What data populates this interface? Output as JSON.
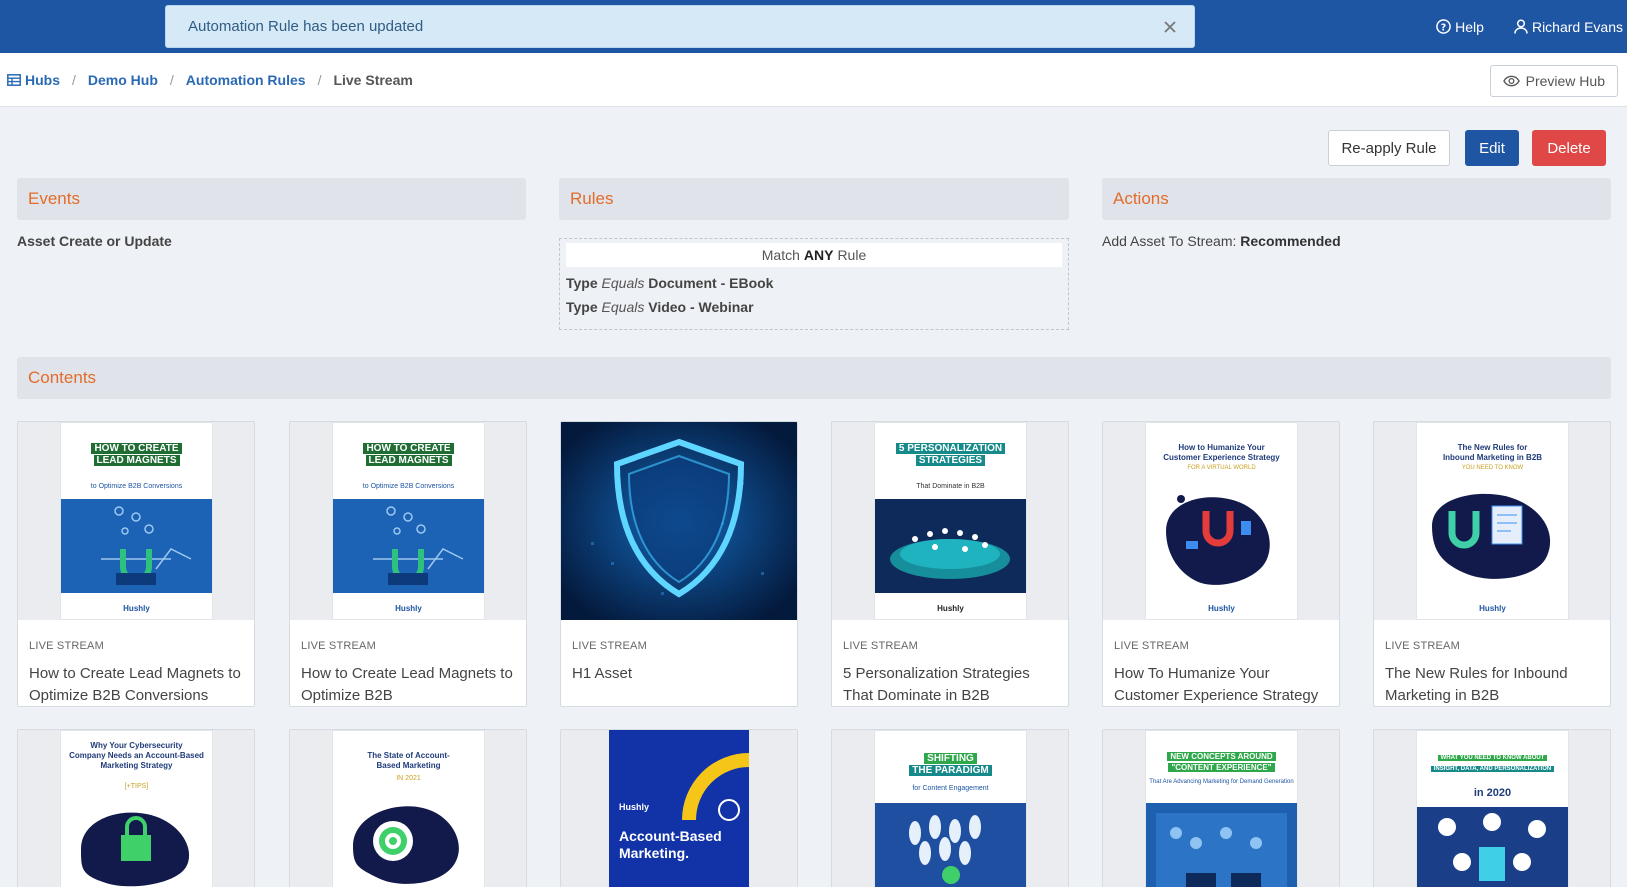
{
  "topbar": {
    "help": "Help",
    "user": "Richard Evans",
    "toast": "Automation Rule has been updated"
  },
  "breadcrumb": {
    "items": [
      "Hubs",
      "Demo Hub",
      "Automation Rules"
    ],
    "current": "Live Stream",
    "preview": "Preview Hub"
  },
  "toolbar": {
    "reapply": "Re-apply Rule",
    "edit": "Edit",
    "delete": "Delete"
  },
  "events": {
    "title": "Events",
    "value": "Asset Create or Update"
  },
  "rules": {
    "title": "Rules",
    "match_prefix": "Match",
    "match_mode": "ANY",
    "match_suffix": "Rule",
    "lines": [
      {
        "field": "Type",
        "op": "Equals",
        "value": "Document - EBook"
      },
      {
        "field": "Type",
        "op": "Equals",
        "value": "Video - Webinar"
      }
    ]
  },
  "actions": {
    "title": "Actions",
    "label": "Add Asset To Stream:",
    "value": "Recommended"
  },
  "contents": {
    "title": "Contents",
    "cards": [
      {
        "tag": "LIVE STREAM",
        "title": "How to Create Lead Magnets to Optimize B2B Conversions",
        "cover_l1": "HOW TO CREATE",
        "cover_l2": "LEAD MAGNETS",
        "cover_sub": "to Optimize B2B Conversions",
        "logo": "Hushly"
      },
      {
        "tag": "LIVE STREAM",
        "title": "How to Create Lead Magnets to Optimize B2B",
        "cover_l1": "HOW TO CREATE",
        "cover_l2": "LEAD MAGNETS",
        "cover_sub": "to Optimize B2B Conversions",
        "logo": "Hushly"
      },
      {
        "tag": "LIVE STREAM",
        "title": "H1 Asset"
      },
      {
        "tag": "LIVE STREAM",
        "title": "5 Personalization Strategies That Dominate in B2B",
        "cover_l1": "5 PERSONALIZATION",
        "cover_l2": "STRATEGIES",
        "cover_sub": "That Dominate in B2B",
        "logo": "Hushly"
      },
      {
        "tag": "LIVE STREAM",
        "title": "How To Humanize Your Customer Experience Strategy",
        "cover_l1": "How to Humanize Your",
        "cover_l2": "Customer Experience Strategy",
        "cover_sub": "FOR A VIRTUAL WORLD",
        "logo": "Hushly"
      },
      {
        "tag": "LIVE STREAM",
        "title": "The New Rules for Inbound Marketing in B2B",
        "cover_l1": "The New Rules for",
        "cover_l2": "Inbound Marketing in B2B",
        "cover_sub": "YOU NEED TO KNOW",
        "logo": "Hushly"
      }
    ],
    "row2": [
      {
        "cover_l1": "Why Your Cybersecurity",
        "cover_l2": "Company Needs an Account-Based Marketing Strategy",
        "cover_sub": "[+TIPS]"
      },
      {
        "cover_l1": "The State of Account-",
        "cover_l2": "Based Marketing",
        "cover_sub": "IN 2021"
      },
      {
        "logo": "Hushly",
        "cover_l1": "Account-Based",
        "cover_l2": "Marketing."
      },
      {
        "cover_l1": "SHIFTING",
        "cover_l2": "THE PARADIGM",
        "cover_sub": "for Content Engagement"
      },
      {
        "cover_l1": "NEW CONCEPTS AROUND",
        "cover_l2": "\"CONTENT EXPERIENCE\"",
        "cover_sub": "That Are Advancing Marketing for Demand Generation"
      },
      {
        "cover_l1": "WHAT YOU NEED TO KNOW ABOUT",
        "cover_l2": "INSIGHT, DATA, AND PERSONALIZATION",
        "cover_sub": "in 2020"
      }
    ]
  },
  "colors": {
    "primary": "#1f56a3",
    "danger": "#e04848",
    "section_title": "#e36c2a",
    "toast_bg": "#d6e9f7"
  }
}
